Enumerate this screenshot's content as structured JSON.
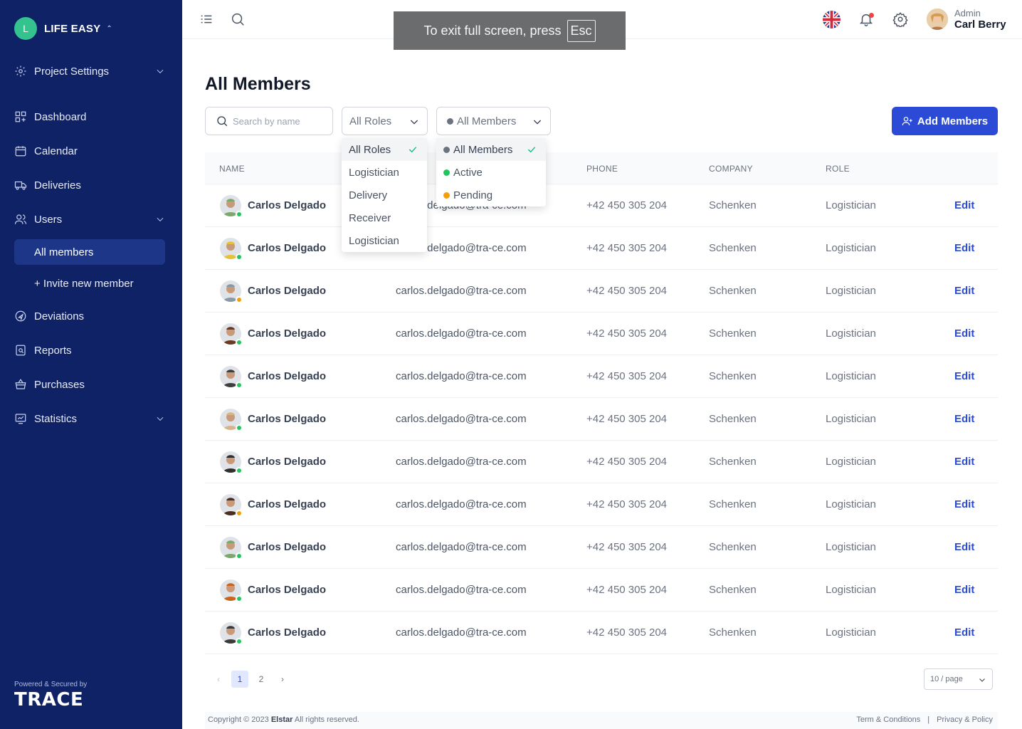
{
  "brand": {
    "initial": "L",
    "name": "LIFE EASY"
  },
  "sidebar": {
    "items": [
      {
        "label": "Project Settings",
        "icon": "gear-icon",
        "has_chevron": true
      },
      {
        "label": "Dashboard",
        "icon": "dashboard-icon",
        "has_chevron": false
      },
      {
        "label": "Calendar",
        "icon": "calendar-icon",
        "has_chevron": false
      },
      {
        "label": "Deliveries",
        "icon": "truck-icon",
        "has_chevron": false
      },
      {
        "label": "Users",
        "icon": "users-icon",
        "has_chevron": true
      },
      {
        "label": "Deviations",
        "icon": "deviation-icon",
        "has_chevron": false
      },
      {
        "label": "Reports",
        "icon": "report-icon",
        "has_chevron": false
      },
      {
        "label": "Purchases",
        "icon": "basket-icon",
        "has_chevron": false
      },
      {
        "label": "Statistics",
        "icon": "statistics-icon",
        "has_chevron": true
      }
    ],
    "sub_items": [
      {
        "label": "All members",
        "active": true
      },
      {
        "label": "+ Invite new member",
        "active": false
      }
    ],
    "powered_by": "Powered & Secured by",
    "logo_text": "TRACE"
  },
  "topbar": {
    "fullscreen_msg": "To exit full screen, press",
    "fullscreen_key": "Esc",
    "user_role": "Admin",
    "user_name": "Carl Berry"
  },
  "main": {
    "title": "All Members",
    "search_placeholder": "Search by name",
    "roles_filter": "All Roles",
    "members_filter": "All Members",
    "add_button": "Add Members"
  },
  "roles_dropdown": [
    "All Roles",
    "Logistician",
    "Delivery",
    "Receiver",
    "Logistician"
  ],
  "members_dropdown": [
    {
      "label": "All Members",
      "color": "#6b7280"
    },
    {
      "label": "Active",
      "color": "#22c55e"
    },
    {
      "label": "Pending",
      "color": "#f59e0b"
    }
  ],
  "table": {
    "headers": [
      "NAME",
      "PHONE",
      "COMPANY",
      "ROLE"
    ],
    "edit_label": "Edit",
    "rows": [
      {
        "name": "Carlos Delgado",
        "email": "carlos.delgado@tra-ce.com",
        "phone": "+42 450 305 204",
        "company": "Schenken",
        "role": "Logistician",
        "status": "active",
        "avatar_color": "#7ea86b"
      },
      {
        "name": "Carlos Delgado",
        "email": "carlos.delgado@tra-ce.com",
        "phone": "+42 450 305 204",
        "company": "Schenken",
        "role": "Logistician",
        "status": "active",
        "avatar_color": "#e6c13a"
      },
      {
        "name": "Carlos Delgado",
        "email": "carlos.delgado@tra-ce.com",
        "phone": "+42 450 305 204",
        "company": "Schenken",
        "role": "Logistician",
        "status": "pending",
        "avatar_color": "#8a99a6"
      },
      {
        "name": "Carlos Delgado",
        "email": "carlos.delgado@tra-ce.com",
        "phone": "+42 450 305 204",
        "company": "Schenken",
        "role": "Logistician",
        "status": "active",
        "avatar_color": "#6b3a22"
      },
      {
        "name": "Carlos Delgado",
        "email": "carlos.delgado@tra-ce.com",
        "phone": "+42 450 305 204",
        "company": "Schenken",
        "role": "Logistician",
        "status": "active",
        "avatar_color": "#3f3f3f"
      },
      {
        "name": "Carlos Delgado",
        "email": "carlos.delgado@tra-ce.com",
        "phone": "+42 450 305 204",
        "company": "Schenken",
        "role": "Logistician",
        "status": "active",
        "avatar_color": "#d8b48a"
      },
      {
        "name": "Carlos Delgado",
        "email": "carlos.delgado@tra-ce.com",
        "phone": "+42 450 305 204",
        "company": "Schenken",
        "role": "Logistician",
        "status": "active",
        "avatar_color": "#2f2f2f"
      },
      {
        "name": "Carlos Delgado",
        "email": "carlos.delgado@tra-ce.com",
        "phone": "+42 450 305 204",
        "company": "Schenken",
        "role": "Logistician",
        "status": "pending",
        "avatar_color": "#4a2e22"
      },
      {
        "name": "Carlos Delgado",
        "email": "carlos.delgado@tra-ce.com",
        "phone": "+42 450 305 204",
        "company": "Schenken",
        "role": "Logistician",
        "status": "active",
        "avatar_color": "#7ea86b"
      },
      {
        "name": "Carlos Delgado",
        "email": "carlos.delgado@tra-ce.com",
        "phone": "+42 450 305 204",
        "company": "Schenken",
        "role": "Logistician",
        "status": "active",
        "avatar_color": "#c8661f"
      },
      {
        "name": "Carlos Delgado",
        "email": "carlos.delgado@tra-ce.com",
        "phone": "+42 450 305 204",
        "company": "Schenken",
        "role": "Logistician",
        "status": "active",
        "avatar_color": "#3a3a3a"
      }
    ]
  },
  "pagination": {
    "prev": "‹",
    "pages": [
      "1",
      "2"
    ],
    "next": "›",
    "current": "1",
    "per_page": "10 / page"
  },
  "footer": {
    "copyright": "Copyright © 2023",
    "company": "Elstar",
    "rights": "All rights reserved.",
    "terms": "Term & Conditions",
    "separator": "|",
    "privacy": "Privacy & Policy"
  },
  "colors": {
    "sidebar_bg": "#0f2266",
    "accent": "#2b4bd6",
    "active_status": "#22c55e",
    "pending_status": "#f59e0b"
  }
}
